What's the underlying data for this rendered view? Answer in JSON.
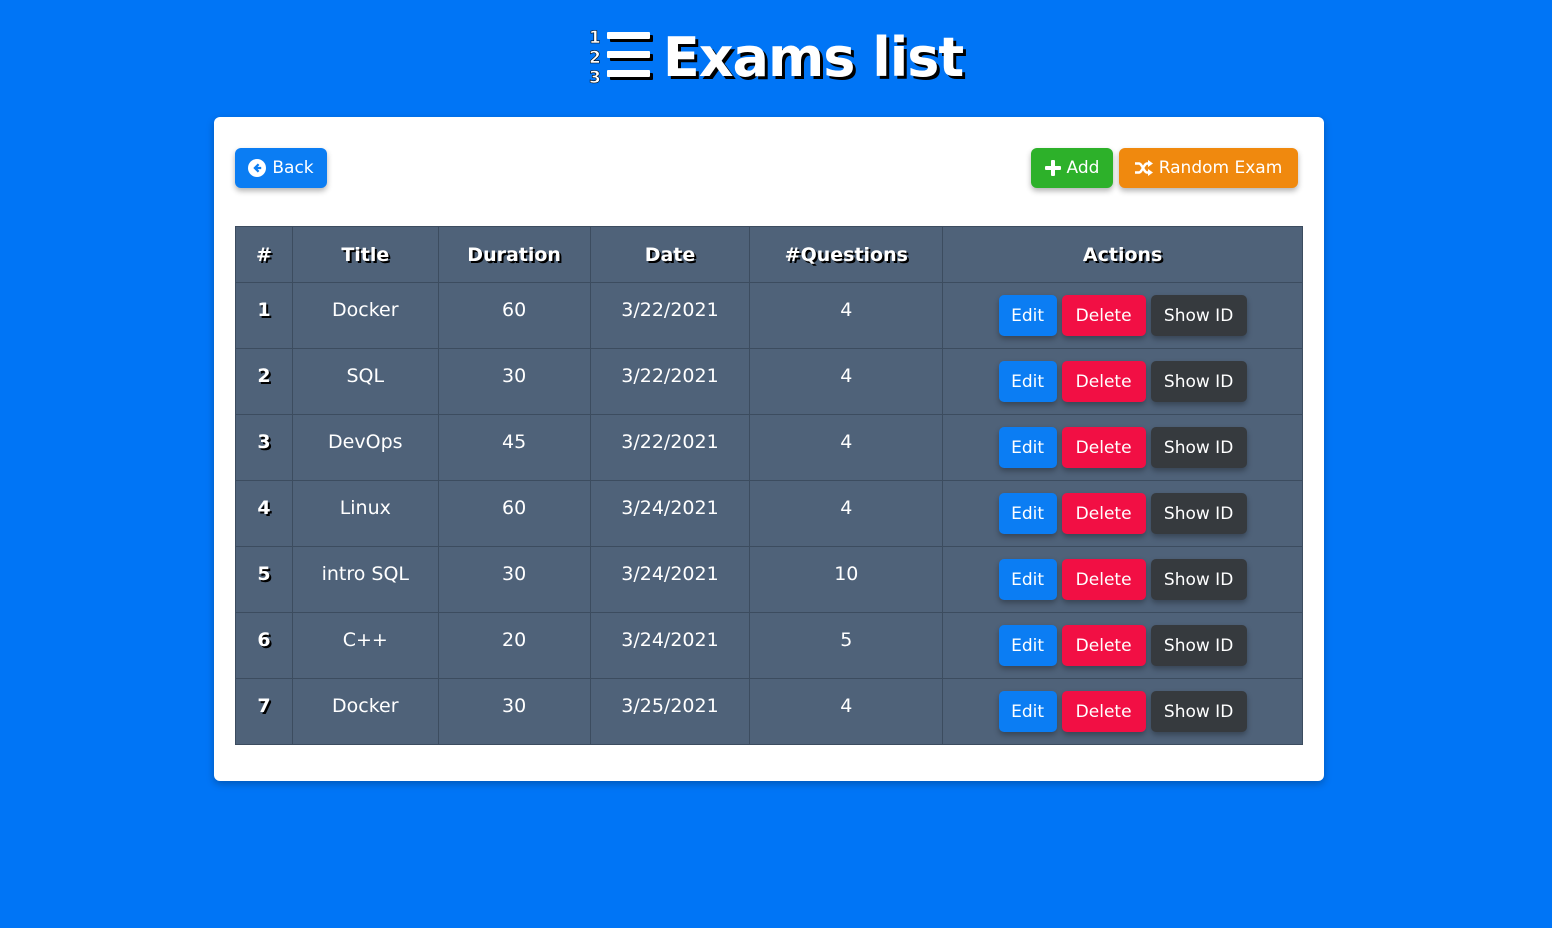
{
  "header": {
    "title": "Exams list",
    "icon": "ordered-list-icon",
    "icon_digits": [
      "1",
      "2",
      "3"
    ]
  },
  "toolbar": {
    "back_label": "Back",
    "back_icon": "arrow-left-circle-icon",
    "add_label": "Add",
    "add_icon": "plus-icon",
    "random_label": "Random Exam",
    "random_icon": "shuffle-icon"
  },
  "table": {
    "headers": [
      "#",
      "Title",
      "Duration",
      "Date",
      "#Questions",
      "Actions"
    ],
    "rows": [
      {
        "num": "1",
        "title": "Docker",
        "duration": "60",
        "date": "3/22/2021",
        "questions": "4"
      },
      {
        "num": "2",
        "title": "SQL",
        "duration": "30",
        "date": "3/22/2021",
        "questions": "4"
      },
      {
        "num": "3",
        "title": "DevOps",
        "duration": "45",
        "date": "3/22/2021",
        "questions": "4"
      },
      {
        "num": "4",
        "title": "Linux",
        "duration": "60",
        "date": "3/24/2021",
        "questions": "4"
      },
      {
        "num": "5",
        "title": "intro SQL",
        "duration": "30",
        "date": "3/24/2021",
        "questions": "10"
      },
      {
        "num": "6",
        "title": "C++",
        "duration": "20",
        "date": "3/24/2021",
        "questions": "5"
      },
      {
        "num": "7",
        "title": "Docker",
        "duration": "30",
        "date": "3/25/2021",
        "questions": "4"
      }
    ],
    "actions": {
      "edit": "Edit",
      "delete": "Delete",
      "show_id": "Show ID"
    }
  },
  "colors": {
    "background": "#0075f6",
    "primary": "#0b7df3",
    "success": "#2db12a",
    "warning": "#f0890e",
    "danger": "#f20f44",
    "dark": "#363a3e",
    "table_bg": "#4f6279"
  }
}
